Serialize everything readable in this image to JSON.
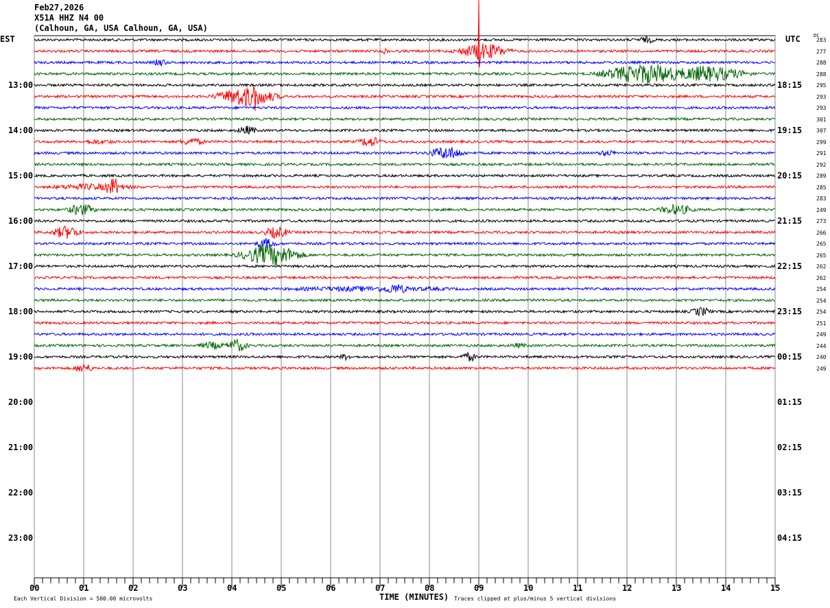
{
  "header": {
    "date": "Feb27,2026",
    "station": "X51A HHZ N4 00",
    "location": "(Calhoun, GA, USA Calhoun, GA, USA)"
  },
  "chart_data": {
    "type": "line",
    "title": "Feb27,2026",
    "xlabel": "TIME (MINUTES)",
    "left_axis_label": "EST",
    "right_axis_label": "UTC",
    "dc_label": "DC",
    "xlim": [
      0,
      15
    ],
    "x_ticks": [
      "00",
      "01",
      "02",
      "03",
      "04",
      "05",
      "06",
      "07",
      "08",
      "09",
      "10",
      "11",
      "12",
      "13",
      "14",
      "15"
    ],
    "left_hour_labels": [
      "13:00",
      "14:00",
      "15:00",
      "16:00",
      "17:00",
      "18:00",
      "19:00",
      "20:00",
      "21:00",
      "22:00",
      "23:00"
    ],
    "right_hour_labels": [
      "18:15",
      "19:15",
      "20:15",
      "21:15",
      "22:15",
      "23:15",
      "00:15",
      "01:15",
      "02:15",
      "03:15",
      "04:15"
    ],
    "trace_colors": [
      "#000000",
      "#ff0000",
      "#0000ff",
      "#006400"
    ],
    "dc_offsets": [
      283,
      277,
      288,
      288,
      295,
      293,
      293,
      301,
      307,
      299,
      291,
      292,
      289,
      285,
      283,
      249,
      273,
      266,
      265,
      265,
      262,
      262,
      254,
      254,
      254,
      251,
      249,
      244,
      240,
      249
    ],
    "events": [
      {
        "trace": 0,
        "minute": 12.4,
        "amp": 5,
        "dur": 0.3
      },
      {
        "trace": 1,
        "minute": 9.1,
        "amp": 12,
        "dur": 0.7
      },
      {
        "trace": 1,
        "minute": 9.0,
        "amp": 80,
        "dur": 0.03
      },
      {
        "trace": 1,
        "minute": 7.1,
        "amp": 5,
        "dur": 0.1
      },
      {
        "trace": 2,
        "minute": 2.55,
        "amp": 6,
        "dur": 0.2
      },
      {
        "trace": 3,
        "minute": 12.4,
        "amp": 15,
        "dur": 1.2
      },
      {
        "trace": 3,
        "minute": 13.6,
        "amp": 12,
        "dur": 1.1
      },
      {
        "trace": 5,
        "minute": 4.3,
        "amp": 15,
        "dur": 0.8
      },
      {
        "trace": 5,
        "minute": 4.45,
        "amp": 35,
        "dur": 0.05
      },
      {
        "trace": 8,
        "minute": 4.3,
        "amp": 7,
        "dur": 0.3
      },
      {
        "trace": 9,
        "minute": 6.8,
        "amp": 8,
        "dur": 0.35
      },
      {
        "trace": 9,
        "minute": 3.2,
        "amp": 6,
        "dur": 0.4
      },
      {
        "trace": 9,
        "minute": 1.3,
        "amp": 4,
        "dur": 0.6
      },
      {
        "trace": 10,
        "minute": 8.35,
        "amp": 10,
        "dur": 0.5
      },
      {
        "trace": 10,
        "minute": 11.6,
        "amp": 5,
        "dur": 0.3
      },
      {
        "trace": 13,
        "minute": 1.6,
        "amp": 14,
        "dur": 0.25
      },
      {
        "trace": 13,
        "minute": 1.2,
        "amp": 5,
        "dur": 1.4
      },
      {
        "trace": 15,
        "minute": 0.95,
        "amp": 9,
        "dur": 0.4
      },
      {
        "trace": 15,
        "minute": 13.0,
        "amp": 8,
        "dur": 0.5
      },
      {
        "trace": 17,
        "minute": 0.65,
        "amp": 10,
        "dur": 0.4
      },
      {
        "trace": 17,
        "minute": 4.9,
        "amp": 9,
        "dur": 0.35
      },
      {
        "trace": 18,
        "minute": 4.7,
        "amp": 8,
        "dur": 0.3
      },
      {
        "trace": 19,
        "minute": 4.8,
        "amp": 16,
        "dur": 0.8
      },
      {
        "trace": 22,
        "minute": 7.3,
        "amp": 8,
        "dur": 0.4
      },
      {
        "trace": 22,
        "minute": 6.8,
        "amp": 4,
        "dur": 3.0
      },
      {
        "trace": 24,
        "minute": 13.5,
        "amp": 7,
        "dur": 0.3
      },
      {
        "trace": 27,
        "minute": 4.1,
        "amp": 10,
        "dur": 0.3
      },
      {
        "trace": 27,
        "minute": 3.6,
        "amp": 6,
        "dur": 0.4
      },
      {
        "trace": 27,
        "minute": 9.8,
        "amp": 4,
        "dur": 0.3
      },
      {
        "trace": 28,
        "minute": 8.8,
        "amp": 7,
        "dur": 0.25
      },
      {
        "trace": 28,
        "minute": 6.3,
        "amp": 5,
        "dur": 0.2
      },
      {
        "trace": 29,
        "minute": 1.0,
        "amp": 7,
        "dur": 0.3
      }
    ],
    "grid": true
  },
  "footer": {
    "scale": "Each Vertical Division =  500.00 microvolts",
    "clip": "Traces clipped at plus/minus 5 vertical divisions"
  }
}
